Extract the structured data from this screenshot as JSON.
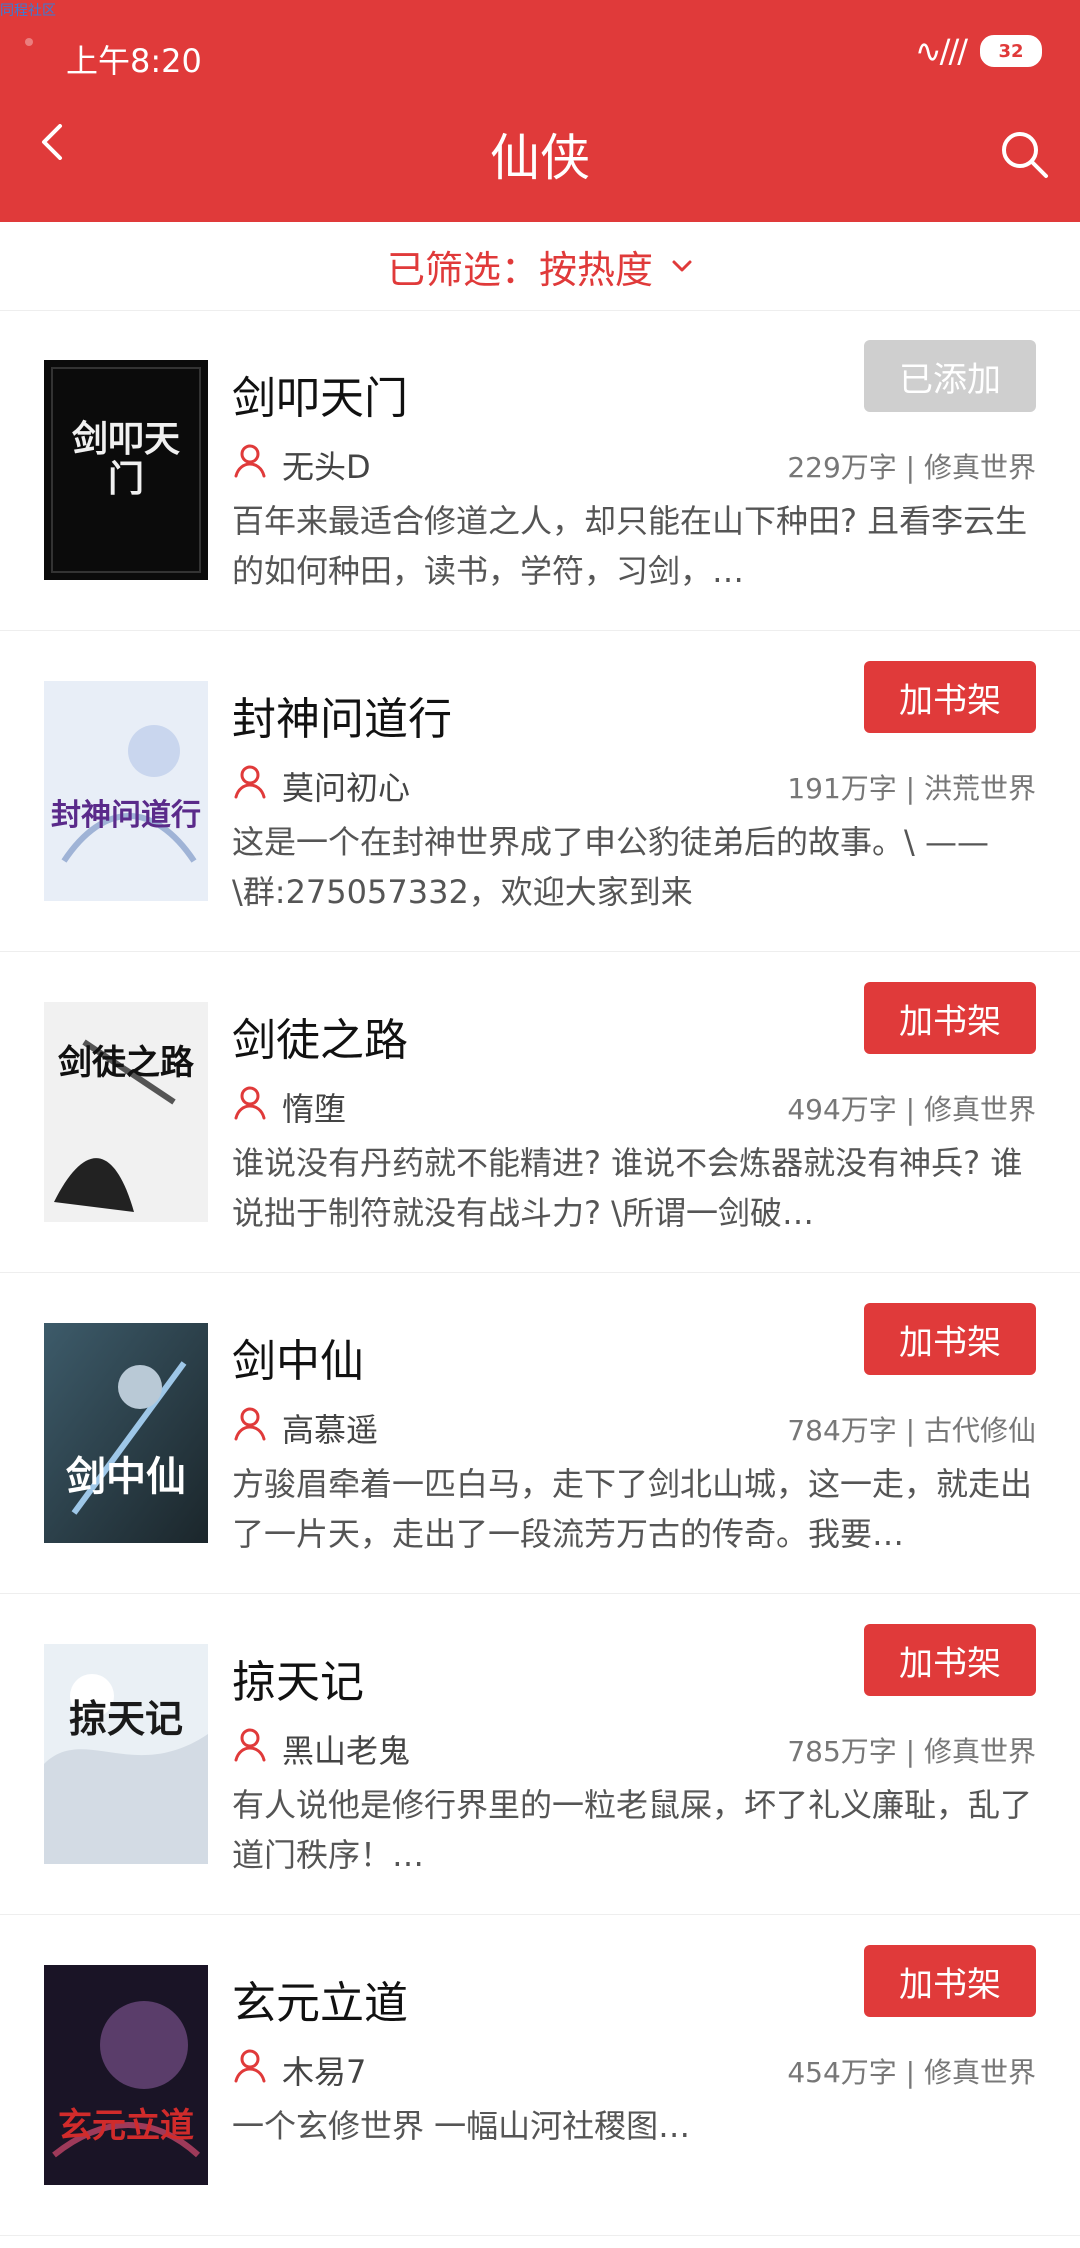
{
  "topleft_tag": "同程社区",
  "status": {
    "time": "上午8:20",
    "battery": "32"
  },
  "header": {
    "title": "仙侠"
  },
  "filter": {
    "label": "已筛选：按热度"
  },
  "books": [
    {
      "title": "剑叩天门",
      "author": "无头D",
      "meta": "229万字 | 修真世界",
      "desc": "百年来最适合修道之人，却只能在山下种田? 且看李云生的如何种田，读书，学符，习剑，…",
      "button": "已添加",
      "added": true,
      "cover_text": "剑叩天门",
      "colors": {
        "bg": "#0b0b0b",
        "fg": "#f0f0f0"
      }
    },
    {
      "title": "封神问道行",
      "author": "莫问初心",
      "meta": "191万字 | 洪荒世界",
      "desc": "这是一个在封神世界成了申公豹徒弟后的故事。\\ ——\\群:275057332，欢迎大家到来",
      "button": "加书架",
      "added": false,
      "cover_text": "封神问道行",
      "colors": {
        "bg": "#e8eef7",
        "fg": "#5a2a8a"
      }
    },
    {
      "title": "剑徒之路",
      "author": "惰堕",
      "meta": "494万字 | 修真世界",
      "desc": "谁说没有丹药就不能精进? 谁说不会炼器就没有神兵? 谁说拙于制符就没有战斗力? \\所谓一剑破…",
      "button": "加书架",
      "added": false,
      "cover_text": "剑徒之路",
      "colors": {
        "bg": "#f1f1f1",
        "fg": "#111111"
      }
    },
    {
      "title": "剑中仙",
      "author": "高慕遥",
      "meta": "784万字 | 古代修仙",
      "desc": "方骏眉牵着一匹白马，走下了剑北山城，这一走，就走出了一片天，走出了一段流芳万古的传奇。我要…",
      "button": "加书架",
      "added": false,
      "cover_text": "剑中仙",
      "colors": {
        "bg": "#2c3f4a",
        "fg": "#ffffff"
      }
    },
    {
      "title": "掠天记",
      "author": "黑山老鬼",
      "meta": "785万字 | 修真世界",
      "desc": "有人说他是修行界里的一粒老鼠屎，坏了礼义廉耻，乱了道门秩序！…",
      "button": "加书架",
      "added": false,
      "cover_text": "掠天记",
      "colors": {
        "bg": "#eaf0f5",
        "fg": "#1a1a1a"
      }
    },
    {
      "title": "玄元立道",
      "author": "木易7",
      "meta": "454万字 | 修真世界",
      "desc": "一个玄修世界 一幅山河社稷图…",
      "button": "加书架",
      "added": false,
      "cover_text": "玄元立道",
      "colors": {
        "bg": "#1a1426",
        "fg": "#d12b2b"
      }
    }
  ]
}
